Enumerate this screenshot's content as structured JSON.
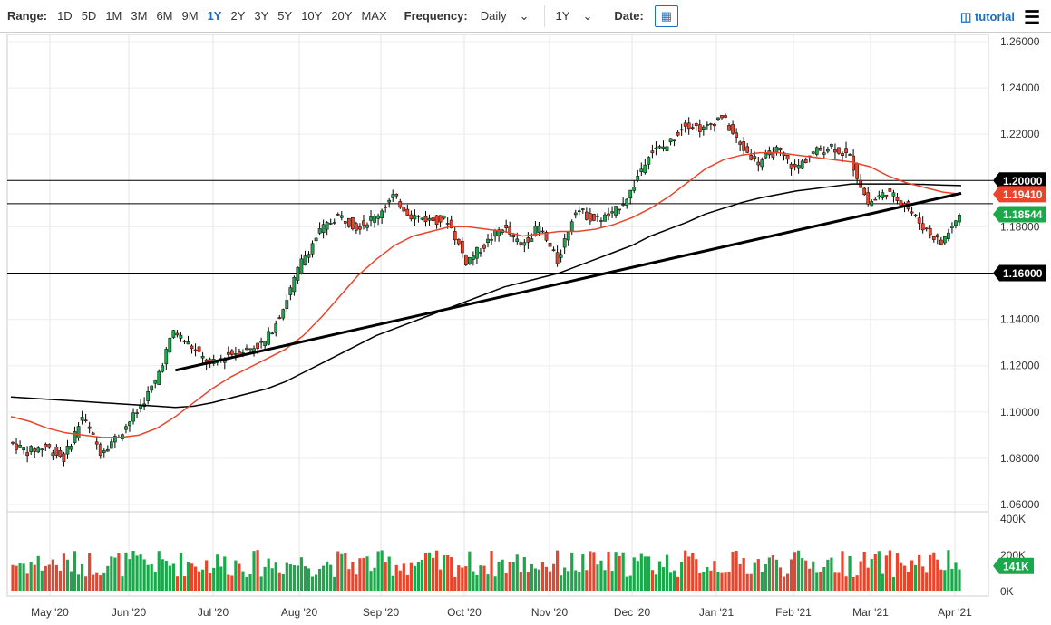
{
  "toolbar": {
    "range_label": "Range:",
    "ranges": [
      "1D",
      "5D",
      "1M",
      "3M",
      "6M",
      "9M",
      "1Y",
      "2Y",
      "3Y",
      "5Y",
      "10Y",
      "20Y",
      "MAX"
    ],
    "active_range": "1Y",
    "frequency_label": "Frequency:",
    "frequency": "Daily",
    "period": "1Y",
    "date_label": "Date:",
    "tutorial": "tutorial"
  },
  "chart_data": {
    "type": "candlestick",
    "title": "",
    "x_ticks": [
      "May '20",
      "Jun '20",
      "Jul '20",
      "Aug '20",
      "Sep '20",
      "Oct '20",
      "Nov '20",
      "Dec '20",
      "Jan '21",
      "Feb '21",
      "Mar '21",
      "Apr '21"
    ],
    "y_ticks": [
      "1.26000",
      "1.24000",
      "1.22000",
      "1.20000",
      "1.18000",
      "1.16000",
      "1.14000",
      "1.12000",
      "1.10000",
      "1.08000",
      "1.06000"
    ],
    "ylim": [
      1.06,
      1.26
    ],
    "weekly_closes": [
      1.087,
      1.083,
      1.085,
      1.08,
      1.098,
      1.083,
      1.09,
      1.1,
      1.113,
      1.135,
      1.128,
      1.12,
      1.125,
      1.127,
      1.13,
      1.145,
      1.165,
      1.178,
      1.185,
      1.18,
      1.184,
      1.193,
      1.185,
      1.183,
      1.183,
      1.165,
      1.172,
      1.18,
      1.172,
      1.18,
      1.165,
      1.188,
      1.183,
      1.185,
      1.195,
      1.212,
      1.215,
      1.225,
      1.222,
      1.228,
      1.215,
      1.208,
      1.213,
      1.205,
      1.212,
      1.215,
      1.21,
      1.19,
      1.195,
      1.19,
      1.18,
      1.173,
      1.185
    ],
    "ma50": [
      1.098,
      1.096,
      1.093,
      1.091,
      1.09,
      1.089,
      1.089,
      1.09,
      1.093,
      1.098,
      1.104,
      1.11,
      1.115,
      1.119,
      1.123,
      1.127,
      1.133,
      1.141,
      1.15,
      1.159,
      1.166,
      1.172,
      1.176,
      1.178,
      1.18,
      1.18,
      1.179,
      1.178,
      1.176,
      1.177,
      1.178,
      1.178,
      1.179,
      1.181,
      1.184,
      1.188,
      1.193,
      1.199,
      1.205,
      1.209,
      1.211,
      1.212,
      1.212,
      1.211,
      1.21,
      1.209,
      1.208,
      1.206,
      1.202,
      1.199,
      1.197,
      1.195,
      1.1941
    ],
    "ma200": [
      1.1065,
      1.106,
      1.1055,
      1.105,
      1.1045,
      1.104,
      1.1035,
      1.103,
      1.1025,
      1.102,
      1.1025,
      1.104,
      1.106,
      1.108,
      1.11,
      1.113,
      1.117,
      1.121,
      1.125,
      1.129,
      1.133,
      1.136,
      1.139,
      1.142,
      1.145,
      1.148,
      1.151,
      1.154,
      1.156,
      1.158,
      1.16,
      1.163,
      1.166,
      1.169,
      1.172,
      1.176,
      1.179,
      1.182,
      1.1855,
      1.188,
      1.1905,
      1.1925,
      1.194,
      1.1955,
      1.1965,
      1.1975,
      1.1985,
      1.1985,
      1.1985,
      1.1985,
      1.1983,
      1.198,
      1.1978
    ],
    "trendline": {
      "start": [
        9,
        1.118
      ],
      "end": [
        52,
        1.1945
      ]
    },
    "horizontal_levels": [
      1.2,
      1.19,
      1.16
    ],
    "price_labels": [
      {
        "text": "1.20000",
        "value": 1.2,
        "color": "#000000"
      },
      {
        "text": "1.19410",
        "value": 1.1941,
        "color": "#e8452c"
      },
      {
        "text": "1.18544",
        "value": 1.18544,
        "color": "#1aa84a"
      },
      {
        "text": "1.16000",
        "value": 1.16,
        "color": "#000000"
      }
    ],
    "volume": {
      "ticks": [
        "400K",
        "200K",
        "0K"
      ],
      "ylim": [
        0,
        400000
      ],
      "last_label": "141K"
    },
    "colors": {
      "up": "#1aa84a",
      "down": "#e8452c",
      "ma50": "#e8452c",
      "ma200": "#000000"
    }
  }
}
